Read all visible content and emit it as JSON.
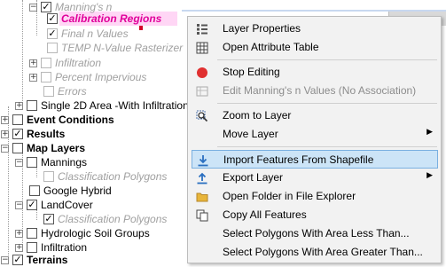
{
  "tree": {
    "mannings_n": "Manning's n",
    "calibration_regions": "Calibration Regions",
    "final_n_values": "Final n Values",
    "temp_n_value": "TEMP N-Value Rasterizer",
    "infiltration_1": "Infiltration",
    "percent_impervious": "Percent Impervious",
    "errors": "Errors",
    "single_2d_area": "Single 2D Area -With Infiltration",
    "event_conditions": "Event Conditions",
    "results": "Results",
    "map_layers": "Map Layers",
    "mannings": "Mannings",
    "classification_polygons_1": "Classification Polygons",
    "google_hybrid": "Google Hybrid",
    "landcover": "LandCover",
    "classification_polygons_2": "Classification Polygons",
    "hydrologic_soil_groups": "Hydrologic Soil Groups",
    "infiltration_2": "Infiltration",
    "terrains": "Terrains"
  },
  "menu": {
    "layer_properties": "Layer Properties",
    "open_attribute_table": "Open Attribute Table",
    "stop_editing": "Stop Editing",
    "edit_mannings": "Edit Manning's n Values (No Association)",
    "zoom_to_layer": "Zoom to Layer",
    "move_layer": "Move Layer",
    "import_features": "Import Features From Shapefile",
    "export_layer": "Export Layer",
    "open_folder": "Open Folder in File Explorer",
    "copy_all_features": "Copy All Features",
    "select_less": "Select Polygons With Area Less Than...",
    "select_greater": "Select Polygons With Area Greater Than..."
  },
  "colors": {
    "highlight_text": "#e0009a",
    "menu_highlight": "#cce4f7",
    "stop_editing_icon": "#e03030"
  }
}
